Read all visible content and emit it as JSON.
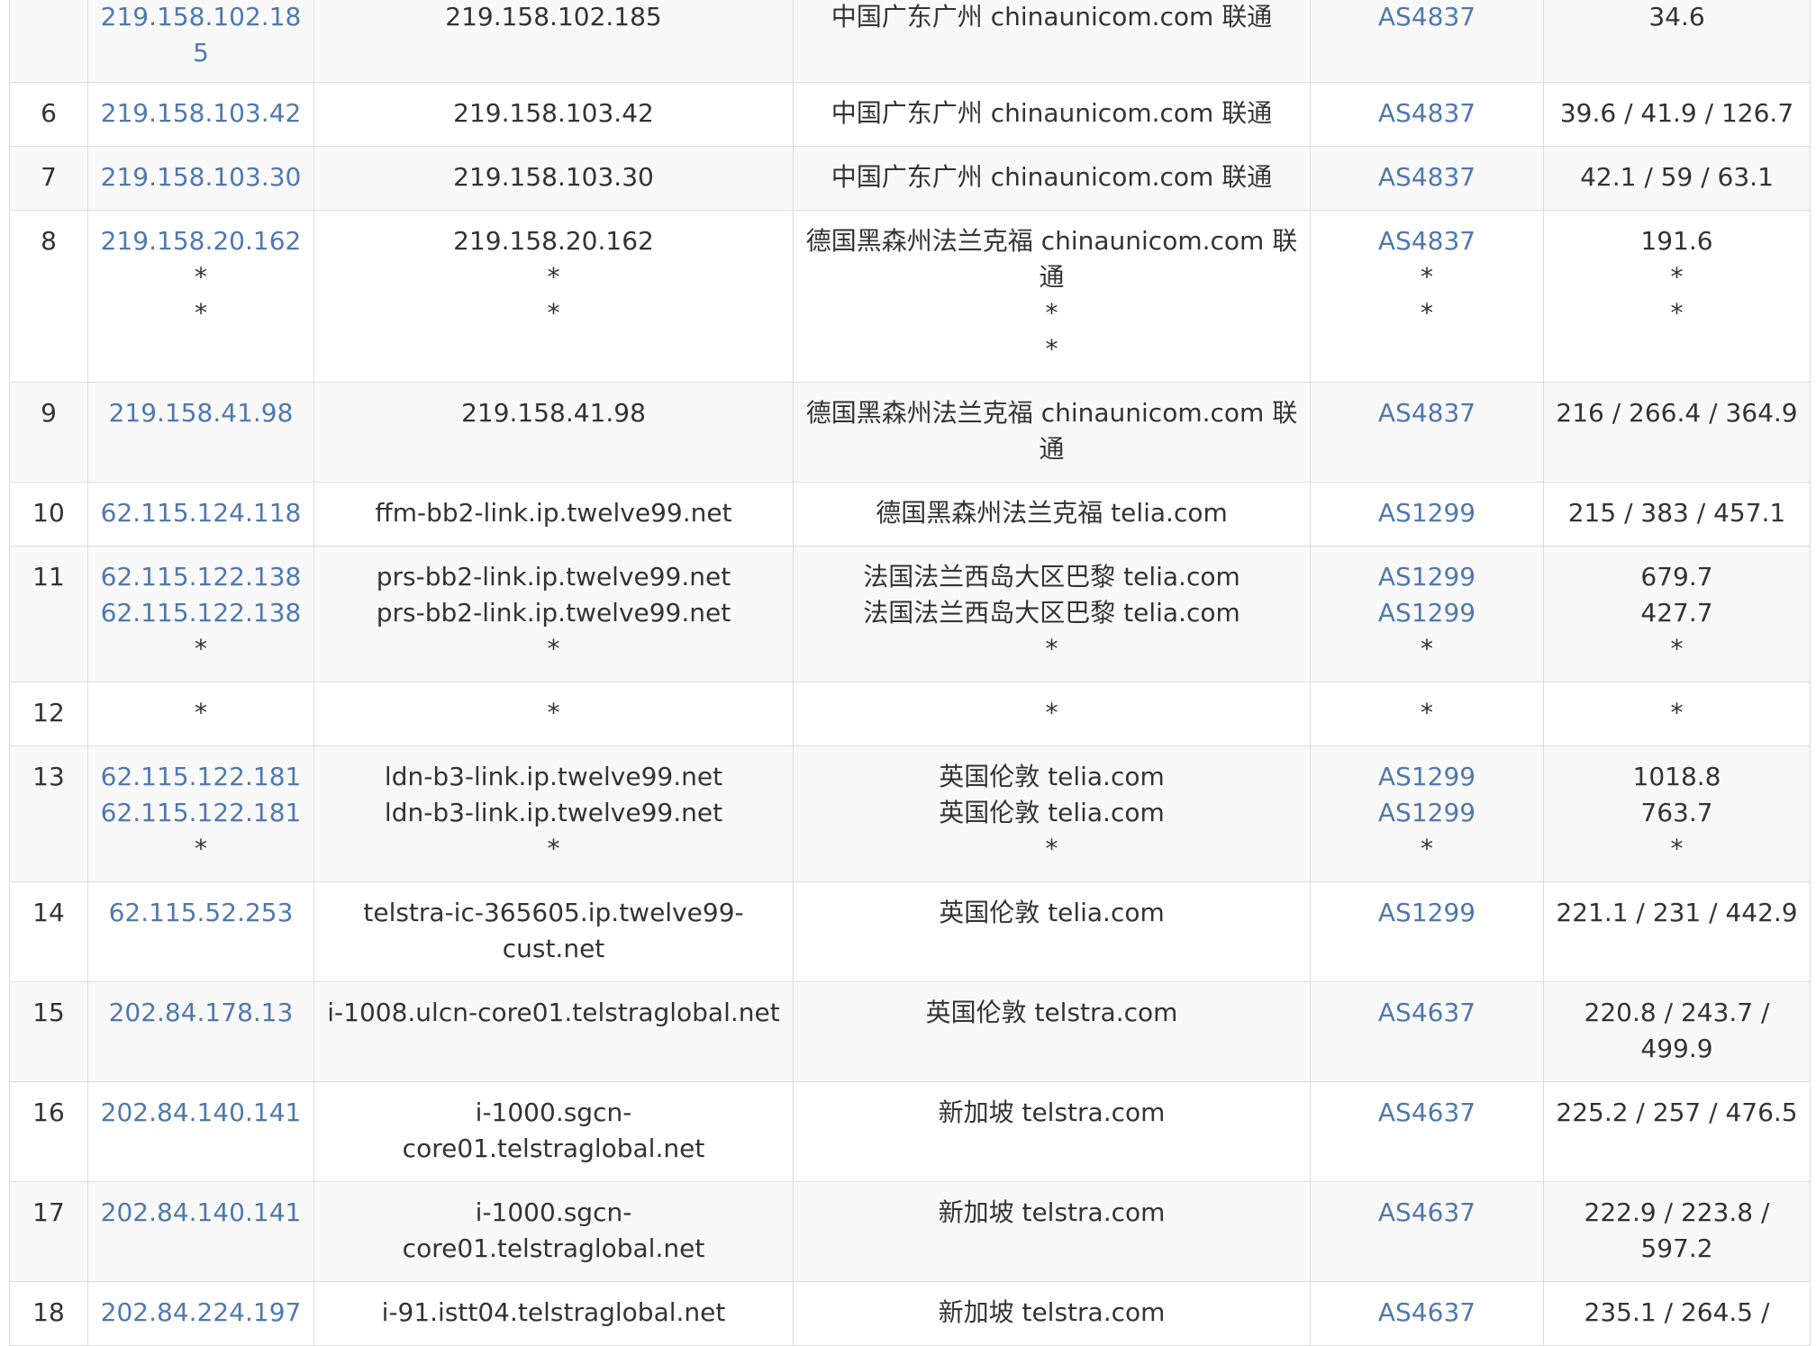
{
  "rows": [
    {
      "hop": "",
      "ip": [
        "219.158.102.185"
      ],
      "host": [
        "219.158.102.185"
      ],
      "loc": [
        "中国广东广州 chinaunicom.com 联通"
      ],
      "as": [
        "AS4837"
      ],
      "rtt": [
        "34.6"
      ]
    },
    {
      "hop": "6",
      "ip": [
        "219.158.103.42"
      ],
      "host": [
        "219.158.103.42"
      ],
      "loc": [
        "中国广东广州 chinaunicom.com 联通"
      ],
      "as": [
        "AS4837"
      ],
      "rtt": [
        "39.6 / 41.9 / 126.7"
      ]
    },
    {
      "hop": "7",
      "ip": [
        "219.158.103.30"
      ],
      "host": [
        "219.158.103.30"
      ],
      "loc": [
        "中国广东广州 chinaunicom.com 联通"
      ],
      "as": [
        "AS4837"
      ],
      "rtt": [
        "42.1 / 59 / 63.1"
      ]
    },
    {
      "hop": "8",
      "ip": [
        "219.158.20.162",
        "*",
        "*"
      ],
      "host": [
        "219.158.20.162",
        "*",
        "*"
      ],
      "loc": [
        "德国黑森州法兰克福 chinaunicom.com 联通",
        "*",
        "*"
      ],
      "as": [
        "AS4837",
        "*",
        "*"
      ],
      "rtt": [
        "191.6",
        "*",
        "*"
      ]
    },
    {
      "hop": "9",
      "ip": [
        "219.158.41.98"
      ],
      "host": [
        "219.158.41.98"
      ],
      "loc": [
        "德国黑森州法兰克福 chinaunicom.com 联通"
      ],
      "as": [
        "AS4837"
      ],
      "rtt": [
        "216 / 266.4 / 364.9"
      ]
    },
    {
      "hop": "10",
      "ip": [
        "62.115.124.118"
      ],
      "host": [
        "ffm-bb2-link.ip.twelve99.net"
      ],
      "loc": [
        "德国黑森州法兰克福 telia.com"
      ],
      "as": [
        "AS1299"
      ],
      "rtt": [
        "215 / 383 / 457.1"
      ]
    },
    {
      "hop": "11",
      "ip": [
        "62.115.122.138",
        "62.115.122.138",
        "*"
      ],
      "host": [
        "prs-bb2-link.ip.twelve99.net",
        "prs-bb2-link.ip.twelve99.net",
        "*"
      ],
      "loc": [
        "法国法兰西岛大区巴黎 telia.com",
        "法国法兰西岛大区巴黎 telia.com",
        "*"
      ],
      "as": [
        "AS1299",
        "AS1299",
        "*"
      ],
      "rtt": [
        "679.7",
        "427.7",
        "*"
      ]
    },
    {
      "hop": "12",
      "ip": [
        "*"
      ],
      "host": [
        "*"
      ],
      "loc": [
        "*"
      ],
      "as": [
        "*"
      ],
      "rtt": [
        "*"
      ]
    },
    {
      "hop": "13",
      "ip": [
        "62.115.122.181",
        "62.115.122.181",
        "*"
      ],
      "host": [
        "ldn-b3-link.ip.twelve99.net",
        "ldn-b3-link.ip.twelve99.net",
        "*"
      ],
      "loc": [
        "英国伦敦 telia.com",
        "英国伦敦 telia.com",
        "*"
      ],
      "as": [
        "AS1299",
        "AS1299",
        "*"
      ],
      "rtt": [
        "1018.8",
        "763.7",
        "*"
      ]
    },
    {
      "hop": "14",
      "ip": [
        "62.115.52.253"
      ],
      "host": [
        "telstra-ic-365605.ip.twelve99-cust.net"
      ],
      "loc": [
        "英国伦敦 telia.com"
      ],
      "as": [
        "AS1299"
      ],
      "rtt": [
        "221.1 / 231 / 442.9"
      ]
    },
    {
      "hop": "15",
      "ip": [
        "202.84.178.13"
      ],
      "host": [
        "i-1008.ulcn-core01.telstraglobal.net"
      ],
      "loc": [
        "英国伦敦 telstra.com"
      ],
      "as": [
        "AS4637"
      ],
      "rtt": [
        "220.8 / 243.7 / 499.9"
      ]
    },
    {
      "hop": "16",
      "ip": [
        "202.84.140.141"
      ],
      "host": [
        "i-1000.sgcn-core01.telstraglobal.net"
      ],
      "loc": [
        "新加坡 telstra.com"
      ],
      "as": [
        "AS4637"
      ],
      "rtt": [
        "225.2 / 257 / 476.5"
      ]
    },
    {
      "hop": "17",
      "ip": [
        "202.84.140.141"
      ],
      "host": [
        "i-1000.sgcn-core01.telstraglobal.net"
      ],
      "loc": [
        "新加坡 telstra.com"
      ],
      "as": [
        "AS4637"
      ],
      "rtt": [
        "222.9 / 223.8 / 597.2"
      ]
    },
    {
      "hop": "18",
      "ip": [
        "202.84.224.197"
      ],
      "host": [
        "i-91.istt04.telstraglobal.net"
      ],
      "loc": [
        "新加坡 telstra.com"
      ],
      "as": [
        "AS4637"
      ],
      "rtt": [
        "235.1 / 264.5 /"
      ]
    }
  ]
}
